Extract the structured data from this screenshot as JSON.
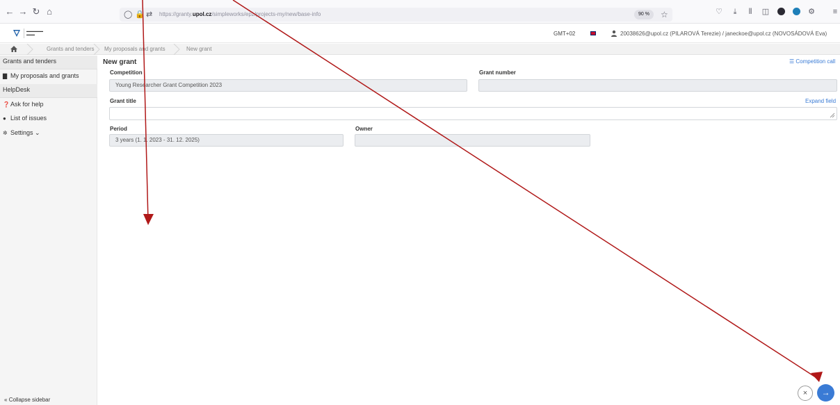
{
  "browser": {
    "url_prefix": "https://granty.",
    "url_domain": "upol.cz",
    "url_path": "/simpleworks/epz/projects-my/new/base-info",
    "zoom": "90 %"
  },
  "header": {
    "timezone": "GMT+02",
    "user": "20038626@upol.cz (PILAROVÁ Terezie) / janeckoe@upol.cz (NOVOSÁDOVÁ Eva)"
  },
  "breadcrumb": {
    "items": [
      "Grants and tenders",
      "My proposals and grants",
      "New grant"
    ]
  },
  "sidebar": {
    "sections": [
      {
        "label": "Grants and tenders"
      },
      {
        "label": "HelpDesk"
      }
    ],
    "items": [
      {
        "label": "My proposals and grants",
        "icon": "file-icon"
      },
      {
        "label": "Ask for help",
        "icon": "question-icon"
      },
      {
        "label": "List of issues",
        "icon": "comment-icon"
      },
      {
        "label": "Settings ⌄",
        "icon": "gear-icon"
      }
    ],
    "collapse_label": "Collapse sidebar"
  },
  "form": {
    "title": "New grant",
    "competition_call": "Competition call",
    "competition_label": "Competition",
    "competition_value": "Young Researcher Grant Competition 2023",
    "grant_number_label": "Grant number",
    "grant_number_value": "",
    "grant_title_label": "Grant title",
    "grant_title_value": "",
    "expand_field": "Expand field",
    "period_label": "Period",
    "period_value": "3 years (1. 1. 2023 - 31. 12. 2025)",
    "owner_label": "Owner",
    "owner_value": ""
  },
  "colors": {
    "accent": "#3a7bd5",
    "annotation_arrow": "#b01818"
  }
}
